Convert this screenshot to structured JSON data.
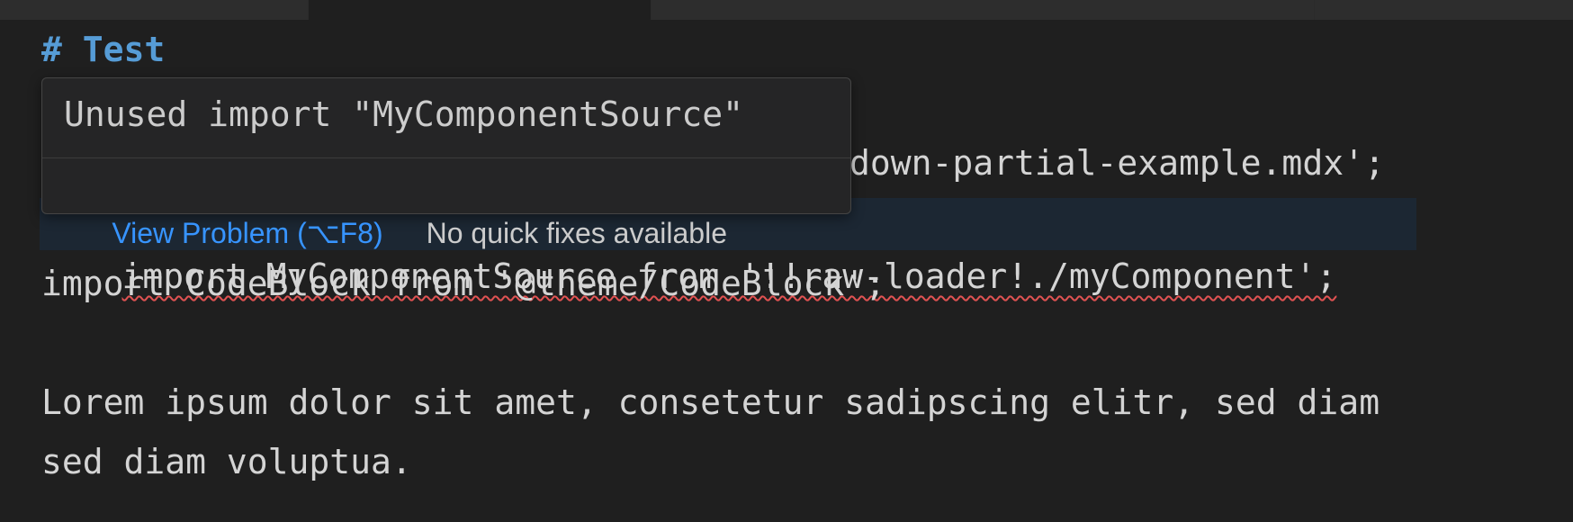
{
  "editor": {
    "lines": {
      "heading": "# Test",
      "partial_import_tail": "down-partial-example.mdx';",
      "unused_import": "import MyComponentSource from '!!raw-loader!./myComponent';",
      "codeblock_import": "import CodeBlock from '@theme/CodeBlock';",
      "lorem_1": "Lorem ipsum dolor sit amet, consetetur sadipscing elitr, sed diam",
      "lorem_2": "sed diam voluptua."
    }
  },
  "hover": {
    "message": "Unused import \"MyComponentSource\"",
    "view_problem": "View Problem (⌥F8)",
    "no_quick_fixes": "No quick fixes available"
  },
  "colors": {
    "background": "#1f1f1f",
    "heading": "#569cd6",
    "link": "#3794ff",
    "squiggle": "#e05252"
  }
}
